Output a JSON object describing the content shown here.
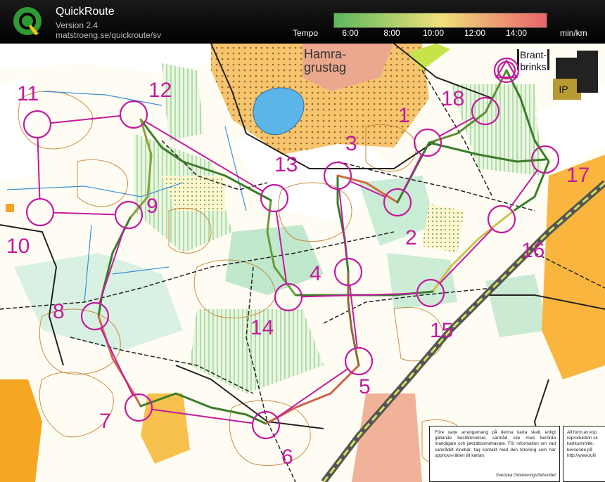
{
  "header": {
    "title": "QuickRoute",
    "version": "Version 2.4",
    "url": "matstroeng.se/quickroute/sv",
    "tempo_label": "Tempo",
    "tempo_ticks": [
      "6:00",
      "8:00",
      "10:00",
      "12:00",
      "14:00"
    ],
    "unit": "min/km"
  },
  "colors": {
    "course": "#c41aa0",
    "route_slow": "#e2514f",
    "route_fast": "#3a7d2a",
    "legend_start": "#5cb85c",
    "legend_mid": "#f0e07a",
    "legend_end": "#e8636b"
  },
  "map": {
    "place_labels": {
      "hamra": "Hamra-\ngrustag",
      "brantbrinks": "Brant-\nbrinks",
      "ip": "IP"
    },
    "controls": [
      {
        "number": "1"
      },
      {
        "number": "2"
      },
      {
        "number": "3"
      },
      {
        "number": "4"
      },
      {
        "number": "5"
      },
      {
        "number": "6"
      },
      {
        "number": "7"
      },
      {
        "number": "8"
      },
      {
        "number": "9"
      },
      {
        "number": "10"
      },
      {
        "number": "11"
      },
      {
        "number": "12"
      },
      {
        "number": "13"
      },
      {
        "number": "14"
      },
      {
        "number": "15"
      },
      {
        "number": "16"
      },
      {
        "number": "17"
      },
      {
        "number": "18"
      }
    ],
    "notice": {
      "text": "Före varje arrangemang på denna karta skall, enligt gällande bestämmelser, samråd ske med berörda markägare och jakträttsinnehavare. För information om vad samrådet innebär, tag kontakt med den förening som har upphovs-rätten till kartan.",
      "signature": "Svenska Orienteringsförbundet"
    },
    "notice2": {
      "lines": [
        "All form av kop",
        "reproduktion sk",
        "kartkommitté.",
        "beroende på",
        "http://www.tulli"
      ]
    }
  }
}
